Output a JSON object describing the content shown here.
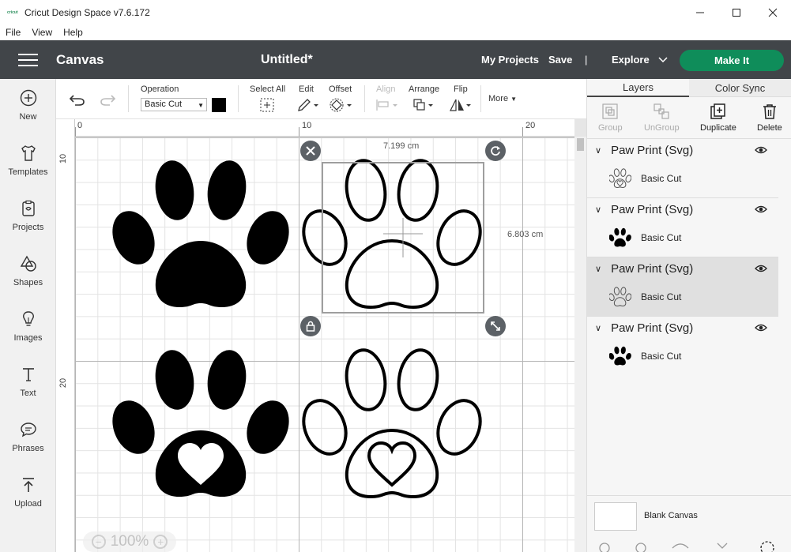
{
  "window": {
    "app_logo_text": "cricut",
    "title": "Cricut Design Space  v7.6.172",
    "controls": [
      "minimize",
      "maximize",
      "close"
    ]
  },
  "menu": [
    "File",
    "View",
    "Help"
  ],
  "header": {
    "section": "Canvas",
    "doc_title": "Untitled*",
    "my_projects": "My Projects",
    "save": "Save",
    "separator": "|",
    "explore": "Explore",
    "make_it": "Make It",
    "make_it_color": "#0f8d5a",
    "bg_color": "#414549"
  },
  "sidebar": [
    {
      "label": "New",
      "icon": "plus-circle-icon"
    },
    {
      "label": "Templates",
      "icon": "shirt-icon"
    },
    {
      "label": "Projects",
      "icon": "projects-icon"
    },
    {
      "label": "Shapes",
      "icon": "shapes-icon"
    },
    {
      "label": "Images",
      "icon": "lightbulb-icon"
    },
    {
      "label": "Text",
      "icon": "text-icon"
    },
    {
      "label": "Phrases",
      "icon": "speech-bubble-icon"
    },
    {
      "label": "Upload",
      "icon": "upload-icon"
    }
  ],
  "toolbar": {
    "operation_label": "Operation",
    "operation_value": "Basic Cut",
    "select_all": "Select All",
    "edit": "Edit",
    "offset": "Offset",
    "align": "Align",
    "arrange": "Arrange",
    "flip": "Flip",
    "more": "More"
  },
  "canvas": {
    "ruler_top": [
      "0",
      "10",
      "20"
    ],
    "ruler_left": [
      "10",
      "20"
    ],
    "width_label": "7.199 cm",
    "height_label": "6.803 cm",
    "zoom": "100%"
  },
  "layers_panel": {
    "tabs": [
      "Layers",
      "Color Sync"
    ],
    "tools": {
      "group": "Group",
      "ungroup": "UnGroup",
      "duplicate": "Duplicate",
      "delete": "Delete"
    },
    "groups": [
      {
        "name": "Paw Print (Svg)",
        "item": "Basic Cut",
        "style": "outline-heart",
        "selected": false
      },
      {
        "name": "Paw Print (Svg)",
        "item": "Basic Cut",
        "style": "solid",
        "selected": false
      },
      {
        "name": "Paw Print (Svg)",
        "item": "Basic Cut",
        "style": "outline",
        "selected": true
      },
      {
        "name": "Paw Print (Svg)",
        "item": "Basic Cut",
        "style": "solid-heart",
        "selected": false
      }
    ],
    "blank_canvas": "Blank Canvas"
  }
}
